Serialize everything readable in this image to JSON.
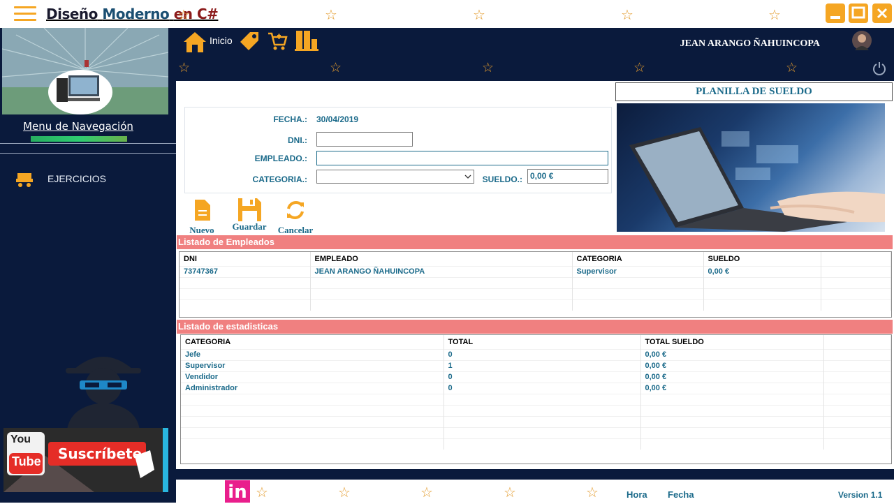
{
  "titlebar": {
    "title_word1": "Diseño",
    "title_word2": "Moderno",
    "title_word3": "en C#",
    "stars": [
      "☆",
      "☆",
      "☆",
      "☆",
      "☆"
    ],
    "minimize_icon": "minimize-icon",
    "maximize_icon": "maximize-icon",
    "close_icon": "close-icon"
  },
  "sidebar": {
    "nav_title": "Menu de Navegación",
    "items": [
      {
        "label": "EJERCICIOS",
        "icon": "truck-icon"
      }
    ],
    "youtube_label": "Suscríbete",
    "youtube_logo_top": "You",
    "youtube_logo_bottom": "Tube"
  },
  "header": {
    "home_label": "Inicio",
    "user_name": "JEAN ARANGO ÑAHUINCOPA"
  },
  "form": {
    "fecha_label": "FECHA.:",
    "fecha_value": "30/04/2019",
    "dni_label": "DNI.:",
    "dni_value": "",
    "empleado_label": "EMPLEADO.:",
    "empleado_value": "",
    "categoria_label": "CATEGORIA.:",
    "categoria_value": "",
    "sueldo_label": "SUELDO.:",
    "sueldo_value": "0,00 €",
    "nuevo_label": "Nuevo",
    "guardar_label": "Guardar",
    "cancelar_label": "Cancelar"
  },
  "panel": {
    "title": "PLANILLA DE SUELDO"
  },
  "empleados": {
    "title": "Listado de Empleados",
    "columns": [
      "DNI",
      "EMPLEADO",
      "CATEGORIA",
      "SUELDO"
    ],
    "rows": [
      {
        "dni": "73747367",
        "empleado": "JEAN ARANGO ÑAHUINCOPA",
        "categoria": "Supervisor",
        "sueldo": "0,00 €"
      }
    ]
  },
  "estadisticas": {
    "title": "Listado de estadisticas",
    "columns": [
      "CATEGORIA",
      "TOTAL",
      "TOTAL SUELDO"
    ],
    "rows": [
      {
        "categoria": "Jefe",
        "total": "0",
        "total_sueldo": "0,00 €"
      },
      {
        "categoria": "Supervisor",
        "total": "1",
        "total_sueldo": "0,00 €"
      },
      {
        "categoria": "Vendidor",
        "total": "0",
        "total_sueldo": "0,00 €"
      },
      {
        "categoria": "Administrador",
        "total": "0",
        "total_sueldo": "0,00 €"
      }
    ]
  },
  "footer": {
    "hora_label": "Hora",
    "fecha_label": "Fecha",
    "version": "Version 1.1",
    "linkedin_logo": "in"
  },
  "colors": {
    "dark_navy": "#0a1a3c",
    "accent_orange": "#f5a623",
    "teal_text": "#1b6a8a",
    "section_header": "#f08080"
  }
}
